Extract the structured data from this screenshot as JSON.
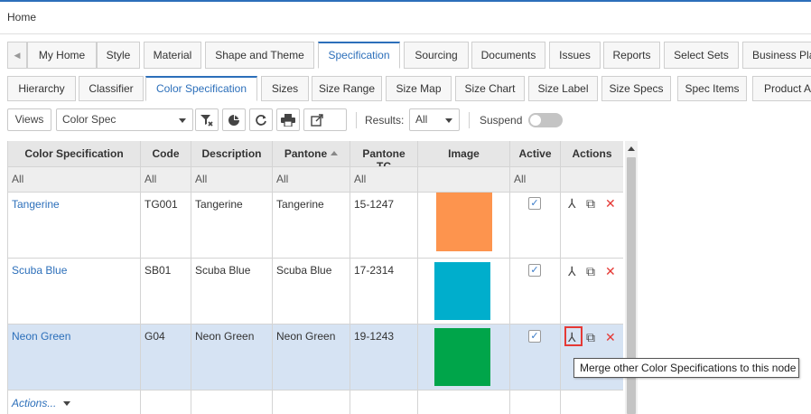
{
  "breadcrumb": "Home",
  "main_tabs": [
    "My Home",
    "Style",
    "Material",
    "Shape and Theme",
    "Specification",
    "Sourcing",
    "Documents",
    "Issues",
    "Reports",
    "Select Sets",
    "Business Pla"
  ],
  "main_tabs_active": "Specification",
  "sub_tabs": [
    "Hierarchy",
    "Classifier",
    "Color Specification",
    "Sizes",
    "Size Range",
    "Size Map",
    "Size Chart",
    "Size Label",
    "Size Specs",
    "Spec Items",
    "Product A"
  ],
  "sub_tabs_active": "Color Specification",
  "toolbar": {
    "views_label": "Views",
    "view_select_value": "Color Spec",
    "results_label": "Results:",
    "results_value": "All",
    "suspend_label": "Suspend",
    "suspend_on": false
  },
  "table": {
    "columns": [
      "Color Specification",
      "Code",
      "Description",
      "Pantone",
      "Pantone TC",
      "Image",
      "Active",
      "Actions"
    ],
    "sorted_column": "Pantone",
    "filters": [
      "All",
      "All",
      "All",
      "All",
      "All",
      "",
      "All",
      ""
    ],
    "rows": [
      {
        "name": "Tangerine",
        "code": "TG001",
        "description": "Tangerine",
        "pantone": "Tangerine",
        "pantone_tc": "15-1247",
        "color": "#fd944e",
        "active": true,
        "selected": false
      },
      {
        "name": "Scuba Blue",
        "code": "SB01",
        "description": "Scuba Blue",
        "pantone": "Scuba Blue",
        "pantone_tc": "17-2314",
        "color": "#00aecc",
        "active": true,
        "selected": false
      },
      {
        "name": "Neon Green",
        "code": "G04",
        "description": "Neon Green",
        "pantone": "Neon Green",
        "pantone_tc": "19-1243",
        "color": "#00a54a",
        "active": true,
        "selected": true
      }
    ],
    "footer_actions": "Actions..."
  },
  "icons": {
    "merge": "merge-icon",
    "copy": "copy-icon",
    "delete": "delete-icon",
    "clear_filter": "clear-filter-icon",
    "chart": "pie-chart-icon",
    "refresh": "refresh-icon",
    "print": "print-icon",
    "export": "export-icon"
  },
  "colors": {
    "accent": "#2c6fba",
    "selected_row": "#d6e3f3",
    "delete": "#e53935"
  },
  "tooltip": "Merge other Color Specifications to this node"
}
